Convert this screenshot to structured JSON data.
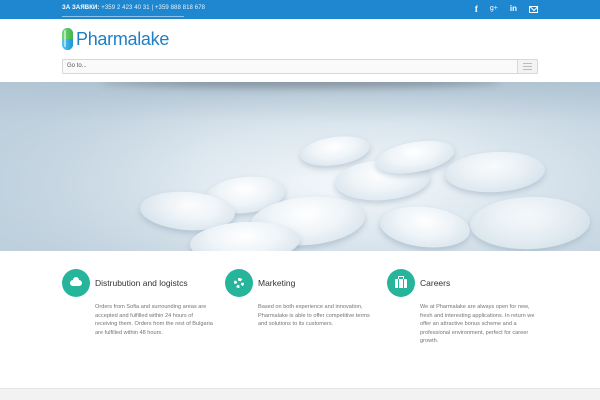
{
  "topbar": {
    "contact_label": "ЗА ЗАЯВКИ:",
    "contact_numbers": "+359 2 423 40 31 | +359 888 818 678",
    "social": [
      {
        "name": "facebook-icon",
        "glyph": "f"
      },
      {
        "name": "google-plus-icon",
        "glyph": "g+"
      },
      {
        "name": "linkedin-icon",
        "glyph": "in"
      },
      {
        "name": "mail-icon",
        "glyph": ""
      }
    ]
  },
  "header": {
    "logo_text": "Pharmalake",
    "nav_placeholder": "Go to..."
  },
  "colors": {
    "topbar_bg": "#1e87d0",
    "logo_text": "#1e7fc4",
    "feature_icon_bg": "#26b49a"
  },
  "features": [
    {
      "icon": "cloud-icon",
      "title": "Distrubution and logistcs",
      "body": "Orders from Sofia and surrounding areas are accepted and fulfilled within 24 hours of receiving them. Orders from the rest of Bulgaria are fulfilled within 48 hours."
    },
    {
      "icon": "gear-icon",
      "title": "Marketing",
      "body": "Based on both experience and innovation, Pharmalake is able to offer competitive terms and solutions to its customers."
    },
    {
      "icon": "briefcase-icon",
      "title": "Careers",
      "body": "We at Pharmalake are always open for new, fresh and interesting applications. In return we offer an attractive bonus scheme and a professional environment, perfect for career growth."
    }
  ]
}
